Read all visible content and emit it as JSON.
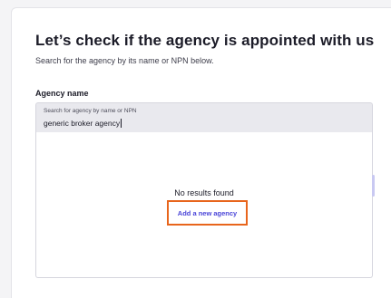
{
  "header": {
    "title": "Let’s check if the agency is appointed with us",
    "subtitle": "Search for the agency by its name or NPN below."
  },
  "agency_field": {
    "label": "Agency name",
    "search_label": "Search for agency by name or NPN",
    "value": "generic broker agency"
  },
  "results": {
    "empty_text": "No results found",
    "add_label": "Add a new agency"
  },
  "colors": {
    "accent": "#4a45d8",
    "highlight": "#e8651c"
  }
}
